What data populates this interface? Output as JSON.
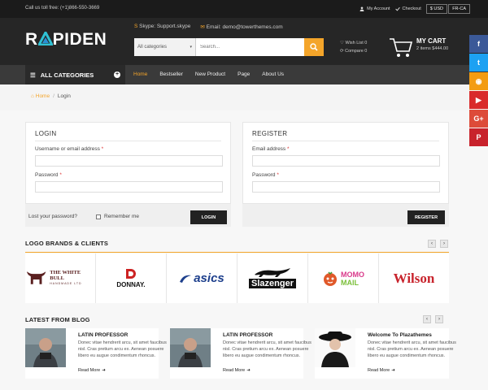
{
  "topbar": {
    "phone": "Call us toll free: (+1)866-550-3669",
    "my_account": "My Account",
    "checkout": "Checkout",
    "currency": "$ USD",
    "language": "FR-CA"
  },
  "header": {
    "logo_prefix": "R",
    "logo_rest": "PIDEN",
    "skype": "Skype: Support.skype",
    "email": "Email: demo@towerthemes.com",
    "search_category": "All categories",
    "search_placeholder": "Search...",
    "wishlist": "Wish List 0",
    "compare": "Compare 0",
    "cart_title": "MY CART",
    "cart_summary": "2 items $444.00"
  },
  "nav": {
    "all_categories": "ALL CATEGORIES",
    "items": [
      {
        "label": "Home",
        "active": true
      },
      {
        "label": "Bestseller"
      },
      {
        "label": "New Product"
      },
      {
        "label": "Page"
      },
      {
        "label": "About Us"
      }
    ]
  },
  "breadcrumb": {
    "home": "Home",
    "sep": "/",
    "current": "Login"
  },
  "login": {
    "title": "LOGIN",
    "username_label": "Username or email address",
    "password_label": "Password",
    "lost_password": "Lost your password?",
    "remember": "Remember me",
    "button": "LOGIN"
  },
  "register": {
    "title": "REGISTER",
    "email_label": "Email address",
    "password_label": "Password",
    "button": "REGISTER"
  },
  "required_mark": "*",
  "brands": {
    "title": "LOGO BRANDS & CLIENTS",
    "prev": "‹",
    "next": "›",
    "items": [
      {
        "name": "THE WHITE BULL",
        "sub": "HANDMADE LTD"
      },
      {
        "name": "DONNAY."
      },
      {
        "name": "asics"
      },
      {
        "name": "Slazenger"
      },
      {
        "name": "MOMO",
        "sub": "MAIL"
      },
      {
        "name": "Wilson"
      }
    ]
  },
  "blog": {
    "title": "LATEST FROM BLOG",
    "prev": "‹",
    "next": "›",
    "posts": [
      {
        "title": "LATIN PROFESSOR",
        "desc": "Donec vitae hendrerit arcu, sit amet faucibus nisl. Cras pretium arcu ex. Aenean posuere libero eu augue condimentum rhoncus.",
        "more": "Read More"
      },
      {
        "title": "LATIN PROFESSOR",
        "desc": "Donec vitae hendrerit arcu, sit amet faucibus nisl. Cras pretium arcu ex. Aenean posuere libero eu augue condimentum rhoncus.",
        "more": "Read More"
      },
      {
        "title": "Welcome To Plazathemes",
        "desc": "Donec vitae hendrerit arcu, sit amet faucibus nisl. Cras pretium arcu ex. Aenean posuere libero eu augue condimentum rhoncus.",
        "more": "Read More"
      }
    ]
  },
  "social": {
    "items": [
      {
        "icon": "facebook-icon",
        "glyph": "f",
        "color": "#3b5998"
      },
      {
        "icon": "twitter-icon",
        "glyph": "t",
        "color": "#1da1f2"
      },
      {
        "icon": "rss-icon",
        "glyph": "◉",
        "color": "#f39c12"
      },
      {
        "icon": "youtube-icon",
        "glyph": "▶",
        "color": "#d92b2b"
      },
      {
        "icon": "google-plus-icon",
        "glyph": "G+",
        "color": "#dd4b39"
      },
      {
        "icon": "pinterest-icon",
        "glyph": "P",
        "color": "#c8232c"
      }
    ]
  },
  "colors": {
    "accent": "#f4a52a",
    "dark": "#262626",
    "brand_cyan": "#2fc1d4"
  }
}
